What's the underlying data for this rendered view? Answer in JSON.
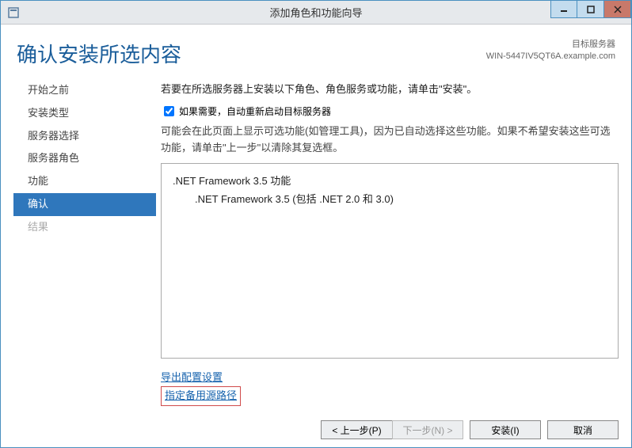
{
  "titlebar": {
    "title": "添加角色和功能向导"
  },
  "header": {
    "page_title": "确认安装所选内容",
    "target_label": "目标服务器",
    "target_name": "WIN-5447IV5QT6A.example.com"
  },
  "sidebar": {
    "steps": [
      {
        "label": "开始之前"
      },
      {
        "label": "安装类型"
      },
      {
        "label": "服务器选择"
      },
      {
        "label": "服务器角色"
      },
      {
        "label": "功能"
      },
      {
        "label": "确认",
        "active": true
      },
      {
        "label": "结果",
        "disabled": true
      }
    ]
  },
  "main": {
    "intro": "若要在所选服务器上安装以下角色、角色服务或功能，请单击\"安装\"。",
    "checkbox_label": "如果需要，自动重新启动目标服务器",
    "note": "可能会在此页面上显示可选功能(如管理工具)，因为已自动选择这些功能。如果不希望安装这些可选功能，请单击\"上一步\"以清除其复选框。",
    "features": [
      {
        "label": ".NET Framework 3.5 功能"
      },
      {
        "label": ".NET Framework 3.5 (包括 .NET 2.0 和 3.0)",
        "sub": true
      }
    ],
    "link_export": "导出配置设置",
    "link_altsource": "指定备用源路径"
  },
  "footer": {
    "prev": "< 上一步(P)",
    "next": "下一步(N) >",
    "install": "安装(I)",
    "cancel": "取消"
  }
}
